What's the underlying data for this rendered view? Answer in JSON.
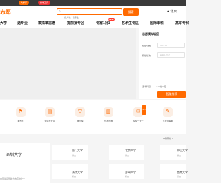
{
  "topbar": {
    "pill1": "大学库",
    "pill2": "升学工具"
  },
  "header": {
    "logo": "志愿",
    "search_placeholder": "搜大学、搜专业",
    "search_button": "搜索",
    "location": "北京"
  },
  "nav": {
    "items": [
      "大学",
      "选专业",
      "模拟填志愿",
      "提前批专区",
      "专家1对1",
      "艺术生专区",
      "国际本科",
      "高职专科",
      "百宝箱"
    ],
    "badge": "NEW"
  },
  "panel": {
    "title": "志愿模拟填报",
    "score_label": "预估分数",
    "score_placeholder": "100-750",
    "rank_label": "预估位次",
    "rank_placeholder": "请输入位次",
    "subject_label": "选考科目",
    "subject_option": "一分一段",
    "submit_label": "智能推荐"
  },
  "quick_links": [
    {
      "icon": "bookmark-icon",
      "glyph": "⚑",
      "label": "报志愿"
    },
    {
      "icon": "document-icon",
      "glyph": "▤",
      "label": "测评找专业"
    },
    {
      "icon": "shield-icon",
      "glyph": "⛉",
      "label": "排行榜"
    },
    {
      "icon": "book-icon",
      "glyph": "▥",
      "label": "位次查询"
    },
    {
      "icon": "chat-icon",
      "glyph": "✉",
      "label": "专家一对一",
      "hot": "HOT"
    },
    {
      "icon": "palette-icon",
      "glyph": "✎",
      "label": "艺术生填报"
    }
  ],
  "more_label": "本科院校",
  "feature": {
    "name": "深圳大学",
    "desc": "中国最具影响力的高校之一"
  },
  "universities": [
    {
      "name": "厦门大学",
      "tag": "综合"
    },
    {
      "name": "北京大学",
      "tag": "综合"
    },
    {
      "name": "中山大学",
      "tag": "综合"
    },
    {
      "name": "清华大学",
      "tag": "综合"
    },
    {
      "name": "苏州大学",
      "tag": "综合"
    },
    {
      "name": "暨南大学",
      "tag": "综合"
    }
  ],
  "colors": {
    "accent": "#ff6a00",
    "dark": "#3a3a3a"
  }
}
